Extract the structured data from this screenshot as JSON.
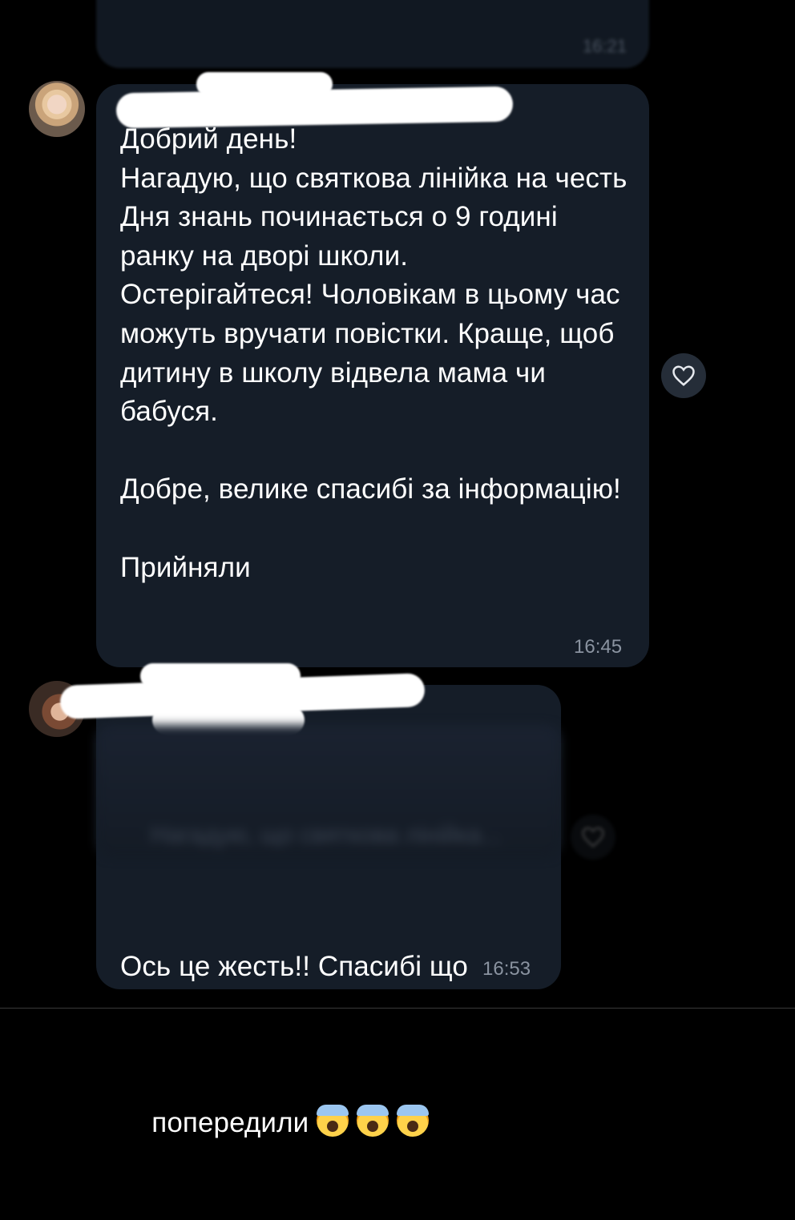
{
  "chat": {
    "previous_message": {
      "time": "16:21"
    },
    "message_1": {
      "text": "Добрий день!\nНагадую, що святкова лінійка на честь Дня знань починається о 9 годині ранку на дворі школи.\nОстерігайтеся! Чоловікам в цьому час можуть вручати повістки. Краще, щоб дитину в школу відвела мама чи бабуся.\n\nДобре, велике спасибі за інформацію!\n\nПрийняли",
      "time": "16:45",
      "like_icon": "heart-outline-icon"
    },
    "message_2": {
      "quoted_text": "Нагадую, що святкова лінійка...",
      "text_line_1": "Ось це жесть!! Спасибі що",
      "text_line_2": "попередили",
      "emoji": "screaming-face-emoji",
      "time": "16:53",
      "like_icon": "heart-outline-icon"
    }
  },
  "colors": {
    "background": "#000000",
    "bubble": "#151d28",
    "text": "#ffffff",
    "time": "#8a93a0"
  }
}
